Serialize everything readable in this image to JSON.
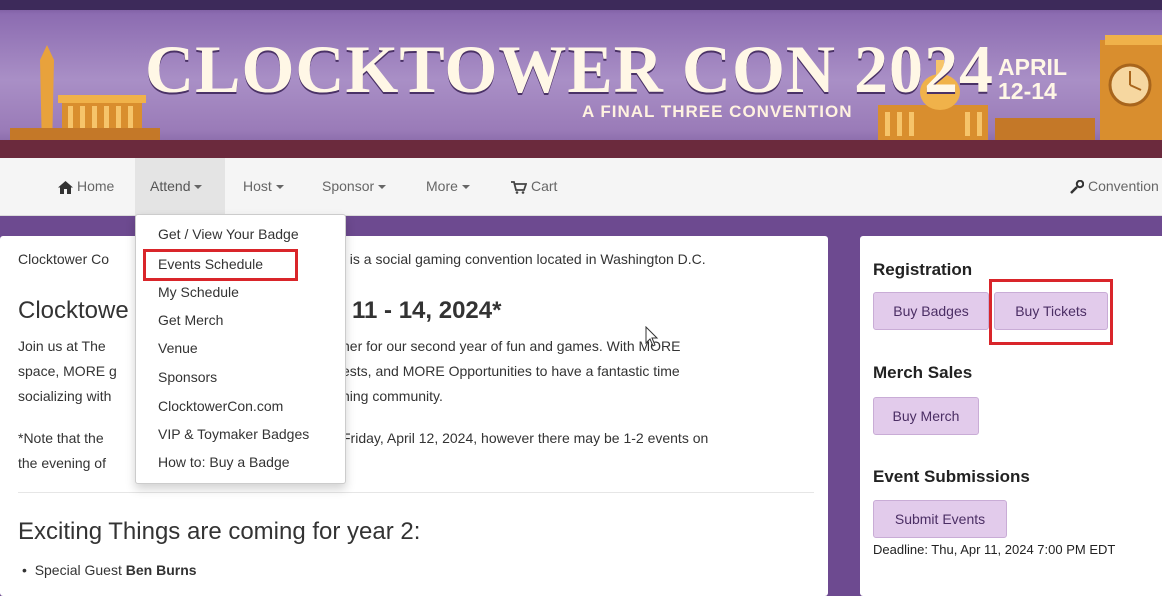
{
  "banner": {
    "title": "CLOCKTOWER CON 2024",
    "subtitle": "A FINAL THREE CONVENTION",
    "date_month": "APRIL",
    "date_days": "12-14"
  },
  "nav": {
    "home": "Home",
    "attend": "Attend",
    "host": "Host",
    "sponsor": "Sponsor",
    "more": "More",
    "cart": "Cart",
    "convention": "Convention"
  },
  "dropdown": {
    "items": [
      "Get / View Your Badge",
      "Events Schedule",
      "My Schedule",
      "Get Merch",
      "Venue",
      "Sponsors",
      "ClocktowerCon.com",
      "VIP & Toymaker Badges",
      "How to: Buy a Badge"
    ]
  },
  "main": {
    "intro_left": "Clocktower Co",
    "intro_right": ", is a social gaming convention located in Washington D.C.",
    "heading_left": "Clocktowe",
    "heading_right": "11 - 14, 2024*",
    "para1_l1_left": "Join us at The",
    "para1_l1_right": "her for our second year of fun and games. With MORE",
    "para1_l2_left": "space, MORE g",
    "para1_l2_right": "ests, and MORE Opportunities to have a fantastic time",
    "para1_l3_left": "socializing with",
    "para1_l3_right": "ning community.",
    "note_l1_left": "*Note that the",
    "note_l1_right": "Friday, April 12, 2024, however there may be 1-2 events on",
    "note_l2_left": "the evening of",
    "section_heading": "Exciting Things are coming for year 2:",
    "bullet_prefix": "Special Guest ",
    "bullet_bold": "Ben Burns"
  },
  "sidebar": {
    "registration_heading": "Registration",
    "buy_badges": "Buy Badges",
    "buy_tickets": "Buy Tickets",
    "merch_heading": "Merch Sales",
    "buy_merch": "Buy Merch",
    "events_heading": "Event Submissions",
    "submit_events": "Submit Events",
    "deadline": "Deadline: Thu, Apr 11, 2024 7:00 PM EDT"
  },
  "colors": {
    "accent_purple": "#6d4a90",
    "button_bg": "#e2cbeb",
    "highlight_red": "#d9252a"
  }
}
